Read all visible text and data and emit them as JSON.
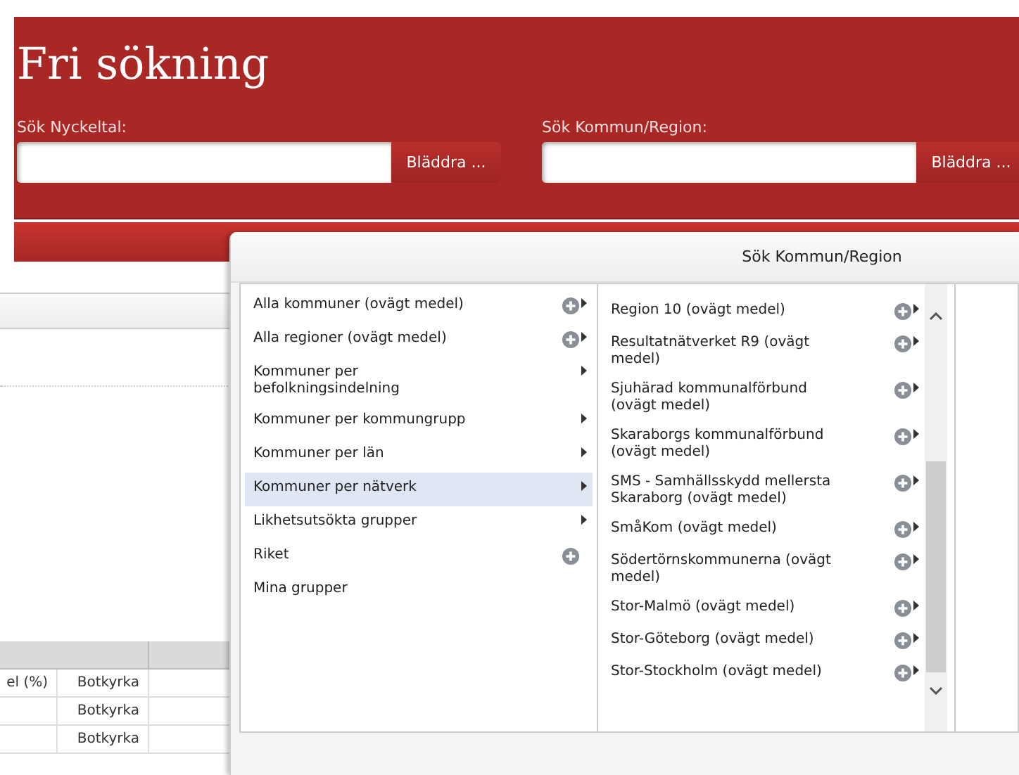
{
  "header": {
    "title": "Fri sökning",
    "searches": [
      {
        "label": "Sök Nyckeltal:",
        "button": "Bläddra ..."
      },
      {
        "label": "Sök Kommun/Region:",
        "button": "Bläddra ..."
      }
    ]
  },
  "table": {
    "rows": [
      {
        "cells": [
          "el (%)",
          "Botkyrka"
        ]
      },
      {
        "cells": [
          "",
          "Botkyrka"
        ]
      },
      {
        "cells": [
          "",
          "Botkyrka"
        ]
      }
    ]
  },
  "dialog": {
    "title": "Sök Kommun/Region",
    "left_list": [
      {
        "label": "Alla kommuner (ovägt medel)",
        "has_add": true,
        "has_submenu": true,
        "selected": false
      },
      {
        "label": "Alla regioner (ovägt medel)",
        "has_add": true,
        "has_submenu": true,
        "selected": false
      },
      {
        "label": "Kommuner per befolkningsindelning",
        "has_add": false,
        "has_submenu": true,
        "selected": false
      },
      {
        "label": "Kommuner per kommungrupp",
        "has_add": false,
        "has_submenu": true,
        "selected": false
      },
      {
        "label": "Kommuner per län",
        "has_add": false,
        "has_submenu": true,
        "selected": false
      },
      {
        "label": "Kommuner per nätverk",
        "has_add": false,
        "has_submenu": true,
        "selected": true
      },
      {
        "label": "Likhetsutsökta grupper",
        "has_add": false,
        "has_submenu": true,
        "selected": false
      },
      {
        "label": "Riket",
        "has_add": true,
        "has_submenu": false,
        "selected": false
      },
      {
        "label": "Mina grupper",
        "has_add": false,
        "has_submenu": false,
        "selected": false
      }
    ],
    "right_list": [
      {
        "label": "Region 10 (ovägt medel)",
        "has_add": true,
        "has_submenu": true
      },
      {
        "label": "Resultatnätverket R9 (ovägt medel)",
        "has_add": true,
        "has_submenu": true
      },
      {
        "label": "Sjuhärad kommunalförbund (ovägt medel)",
        "has_add": true,
        "has_submenu": true
      },
      {
        "label": "Skaraborgs kommunalförbund (ovägt medel)",
        "has_add": true,
        "has_submenu": true
      },
      {
        "label": "SMS - Samhällsskydd mellersta Skaraborg (ovägt medel)",
        "has_add": true,
        "has_submenu": true
      },
      {
        "label": "SmåKom (ovägt medel)",
        "has_add": true,
        "has_submenu": true
      },
      {
        "label": "Södertörnskommunerna (ovägt medel)",
        "has_add": true,
        "has_submenu": true
      },
      {
        "label": "Stor-Malmö (ovägt medel)",
        "has_add": true,
        "has_submenu": true
      },
      {
        "label": "Stor-Göteborg (ovägt medel)",
        "has_add": true,
        "has_submenu": true
      },
      {
        "label": "Stor-Stockholm (ovägt medel)",
        "has_add": true,
        "has_submenu": true
      }
    ]
  }
}
